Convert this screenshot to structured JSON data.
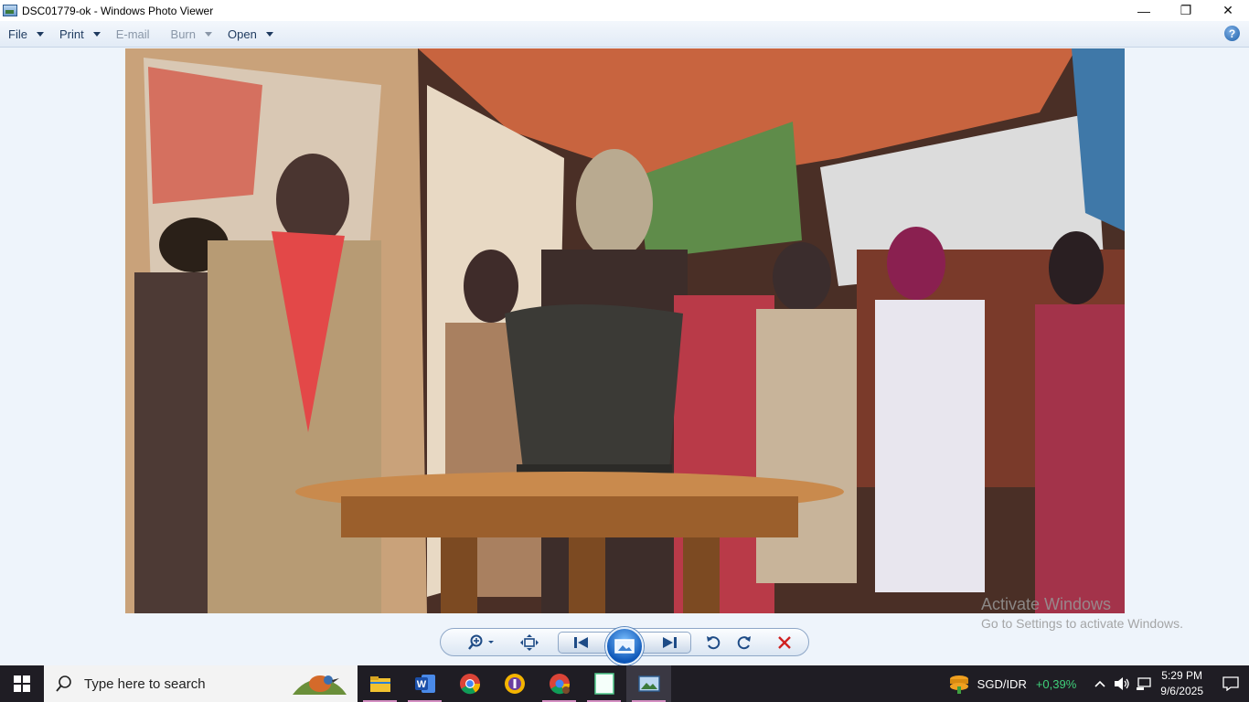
{
  "window": {
    "title": "DSC01779-ok - Windows Photo Viewer",
    "controls": {
      "minimize": "—",
      "maximize": "❐",
      "close": "✕"
    }
  },
  "menu": {
    "items": [
      {
        "label": "File",
        "enabled": true
      },
      {
        "label": "Print",
        "enabled": true
      },
      {
        "label": "E-mail",
        "enabled": false
      },
      {
        "label": "Burn",
        "enabled": false
      },
      {
        "label": "Open",
        "enabled": true
      }
    ],
    "help": "?"
  },
  "watermark": {
    "line1": "Activate Windows",
    "line2": "Go to Settings to activate Windows."
  },
  "toolbar": {
    "buttons": [
      "zoom-icon",
      "fit-window-icon",
      "previous-icon",
      "slideshow-icon",
      "next-icon",
      "rotate-ccw-icon",
      "rotate-cw-icon",
      "delete-icon"
    ],
    "accent": "#1e4b86",
    "delete_color": "#d02020"
  },
  "taskbar": {
    "search_placeholder": "Type here to search",
    "apps": [
      "file-explorer-icon",
      "word-icon",
      "chrome-icon",
      "vpn-icon",
      "chrome-profile-icon",
      "notepad-icon",
      "photo-viewer-icon"
    ],
    "ticker": {
      "pair": "SGD/IDR",
      "change": "+0,39%"
    },
    "clock": {
      "time": "5:29 PM",
      "date": "9/6/2025"
    }
  }
}
